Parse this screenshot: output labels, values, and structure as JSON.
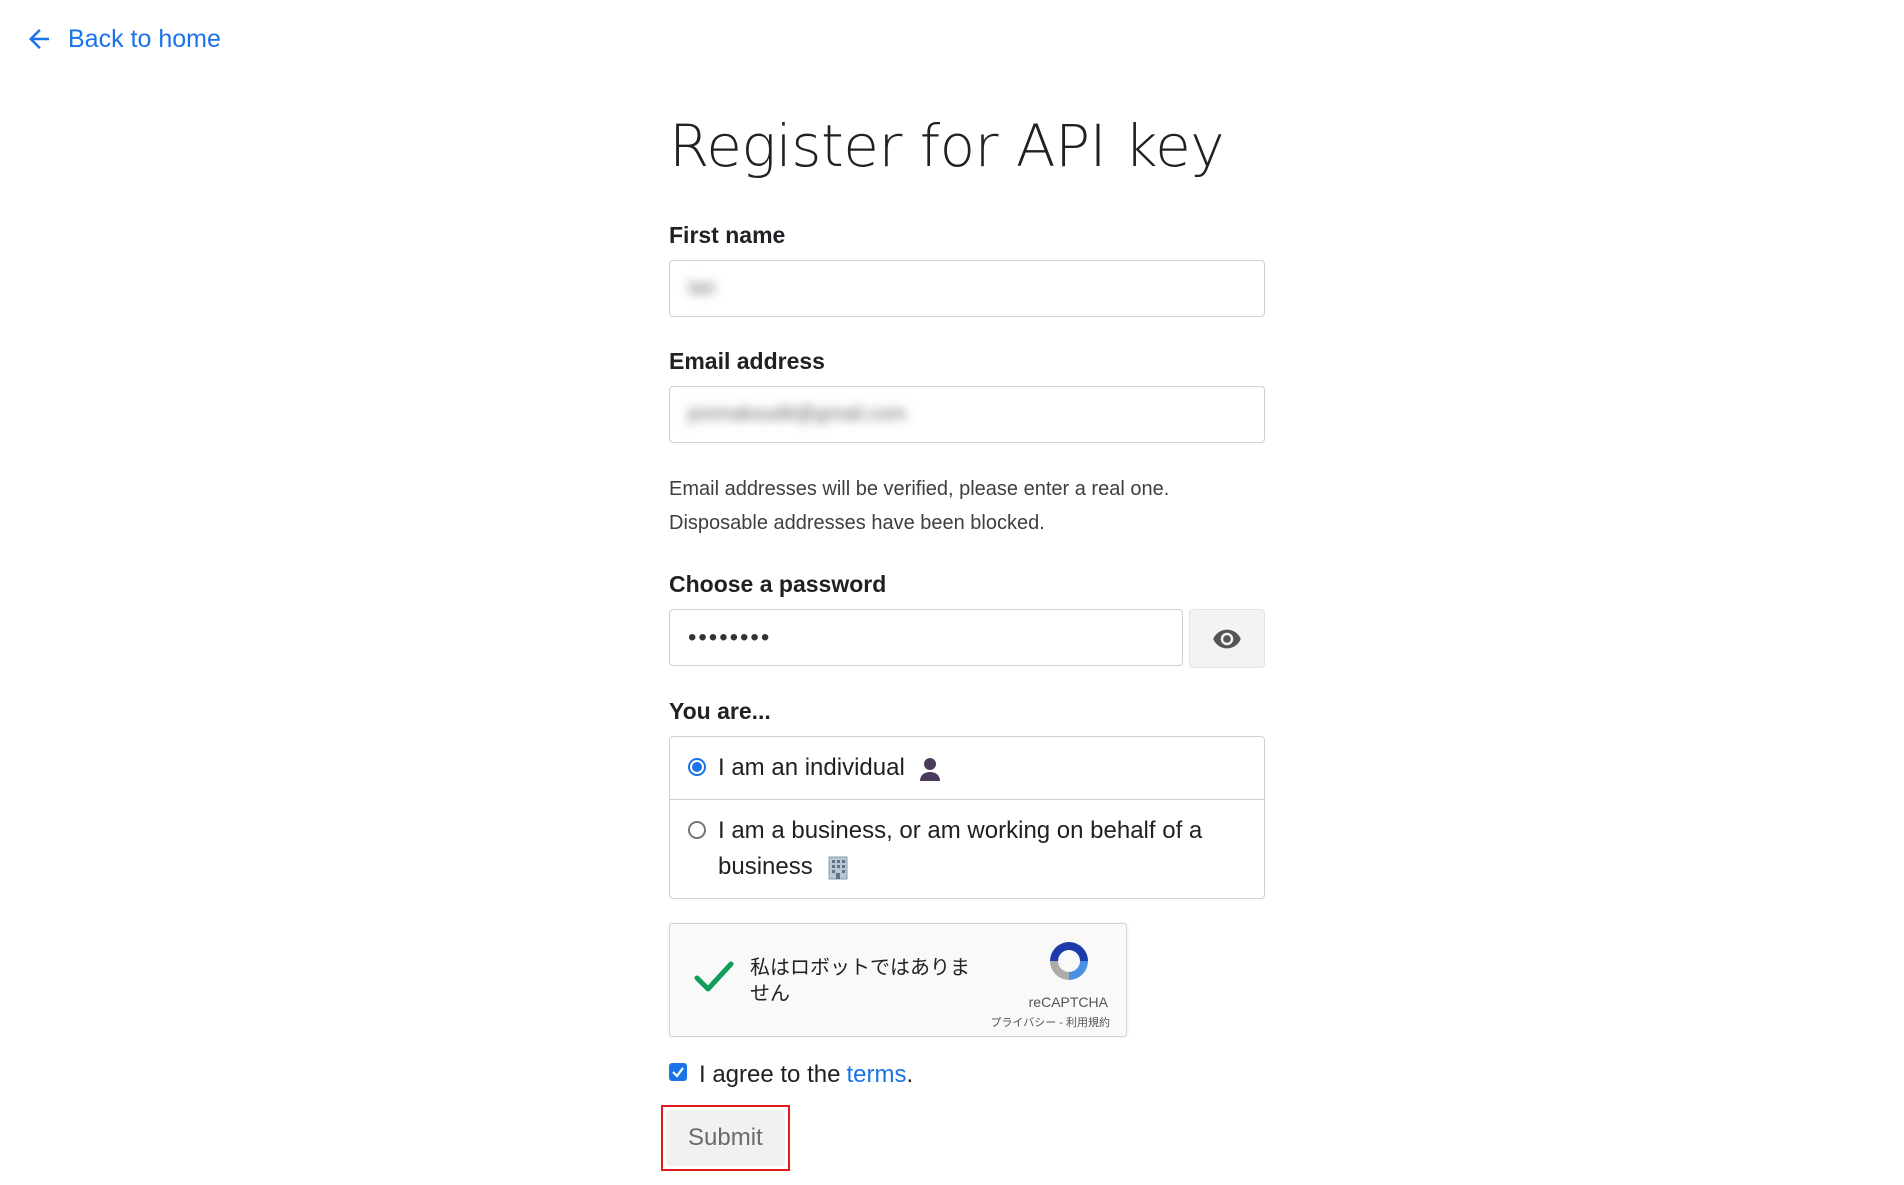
{
  "nav": {
    "back_label": "Back to home"
  },
  "page": {
    "title": "Register for API key"
  },
  "form": {
    "first_name_label": "First name",
    "first_name_value": "Ian",
    "email_label": "Email address",
    "email_value": "jonmaksudit@gmail.com",
    "email_helper_line1": "Email addresses will be verified, please enter a real one.",
    "email_helper_line2": "Disposable addresses have been blocked.",
    "password_label": "Choose a password",
    "password_value": "••••••••",
    "you_are_label": "You are...",
    "options": [
      {
        "label": "I am an individual",
        "selected": true,
        "icon": "person-emoji"
      },
      {
        "label": "I am a business, or am working on behalf of a business",
        "selected": false,
        "icon": "office-building-emoji"
      }
    ],
    "agree_prefix": "I agree to the",
    "terms_label": "terms",
    "agree_suffix": ".",
    "agree_checked": true,
    "submit_label": "Submit"
  },
  "recaptcha": {
    "text": "私はロボットではありません",
    "brand": "reCAPTCHA",
    "links": "プライバシー - 利用規約",
    "checked": true
  },
  "colors": {
    "accent": "#1a73e8",
    "highlight": "#e01919"
  }
}
